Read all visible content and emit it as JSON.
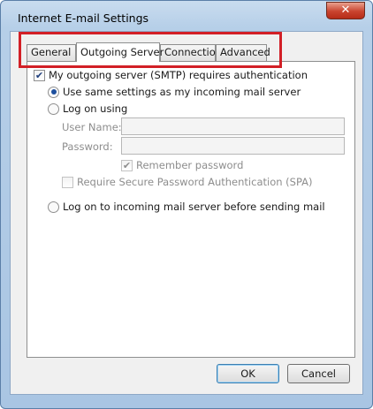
{
  "window": {
    "title": "Internet E-mail Settings",
    "close_label": "✕"
  },
  "tabs": [
    {
      "label": "General"
    },
    {
      "label": "Outgoing Server",
      "active": true
    },
    {
      "label": "Connection"
    },
    {
      "label": "Advanced"
    }
  ],
  "outgoing": {
    "smtp_auth_label": "My outgoing server (SMTP) requires authentication",
    "smtp_auth_checked": true,
    "use_same_label": "Use same settings as my incoming mail server",
    "log_on_using_label": "Log on using",
    "user_name_label": "User Name:",
    "user_name_value": "",
    "password_label": "Password:",
    "password_value": "",
    "remember_label": "Remember password",
    "remember_checked": true,
    "spa_label": "Require Secure Password Authentication (SPA)",
    "spa_checked": false,
    "log_on_incoming_label": "Log on to incoming mail server before sending mail",
    "selected_option": "use_same"
  },
  "buttons": {
    "ok": "OK",
    "cancel": "Cancel"
  },
  "colors": {
    "highlight_border": "#d21f26",
    "close_button": "#c9442f"
  }
}
